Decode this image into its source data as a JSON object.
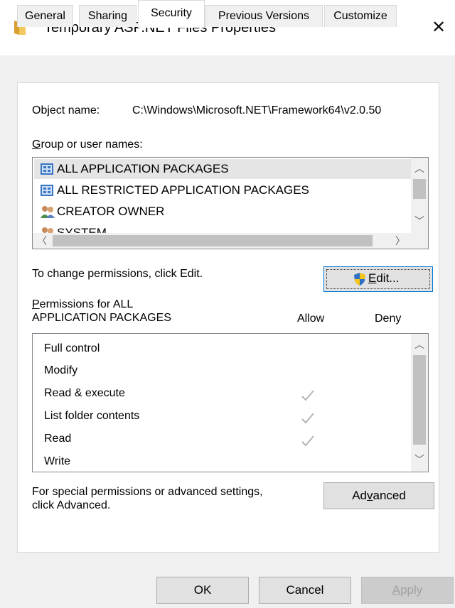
{
  "window": {
    "title": "Temporary ASP.NET Files Properties",
    "close_glyph": "✕"
  },
  "tabs": [
    "General",
    "Sharing",
    "Security",
    "Previous Versions",
    "Customize"
  ],
  "active_tab": "Security",
  "object": {
    "label": "Object name:",
    "value": "C:\\Windows\\Microsoft.NET\\Framework64\\v2.0.50"
  },
  "groups": {
    "label_u": "G",
    "label_rest": "roup or user names:",
    "items": [
      {
        "name": "ALL APPLICATION PACKAGES",
        "icon": "package-group-icon",
        "selected": true
      },
      {
        "name": "ALL RESTRICTED APPLICATION PACKAGES",
        "icon": "package-group-icon",
        "selected": false
      },
      {
        "name": "CREATOR OWNER",
        "icon": "users-icon",
        "selected": false
      },
      {
        "name": "SYSTEM",
        "icon": "users-icon",
        "selected": false
      }
    ]
  },
  "change_hint": "To change permissions, click Edit.",
  "edit_button": {
    "u": "E",
    "rest": "dit..."
  },
  "permissions": {
    "title_u": "P",
    "title_line1_rest": "ermissions for ALL",
    "title_line2": "APPLICATION PACKAGES",
    "allow_header": "Allow",
    "deny_header": "Deny",
    "rows": [
      {
        "name": "Full control",
        "allow": false,
        "deny": false
      },
      {
        "name": "Modify",
        "allow": false,
        "deny": false
      },
      {
        "name": "Read & execute",
        "allow": true,
        "deny": false
      },
      {
        "name": "List folder contents",
        "allow": true,
        "deny": false
      },
      {
        "name": "Read",
        "allow": true,
        "deny": false
      },
      {
        "name": "Write",
        "allow": false,
        "deny": false
      }
    ]
  },
  "advanced_hint": {
    "line1": "For special permissions or advanced settings,",
    "line2": "click Advanced."
  },
  "advanced_button": {
    "pre": "Ad",
    "u": "v",
    "post": "anced"
  },
  "footer": {
    "ok": "OK",
    "cancel": "Cancel",
    "apply_u": "A",
    "apply_rest": "pply"
  },
  "colors": {
    "selection": "#e5e5e5",
    "check": "#b4b4b4",
    "default_border": "#0078d7",
    "folder": "#e8b84a"
  }
}
